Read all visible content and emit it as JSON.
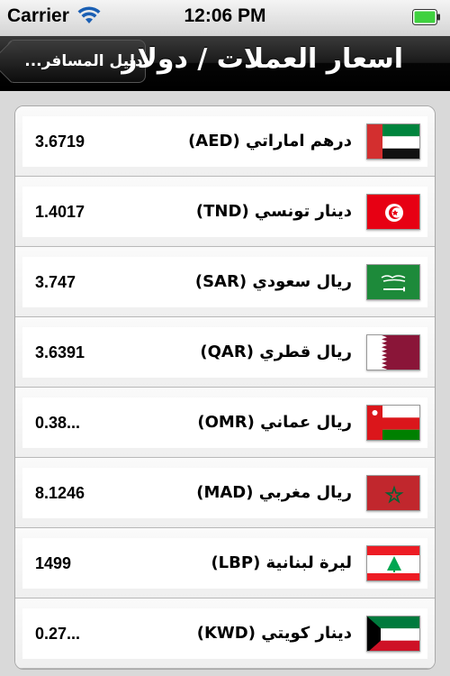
{
  "status_bar": {
    "carrier": "Carrier",
    "time": "12:06 PM"
  },
  "nav": {
    "title": "اسعار العملات / دولار",
    "back_label": "دليل المسافر..."
  },
  "currencies": [
    {
      "name": "درهم اماراتي (AED)",
      "value": "3.6719",
      "flag": "uae-flag-icon"
    },
    {
      "name": "دينار تونسي (TND)",
      "value": "1.4017",
      "flag": "tunisia-flag-icon"
    },
    {
      "name": "ريال سعودي (SAR)",
      "value": "3.747",
      "flag": "saudi-flag-icon"
    },
    {
      "name": "ريال قطري (QAR)",
      "value": "3.6391",
      "flag": "qatar-flag-icon"
    },
    {
      "name": "ريال عماني (OMR)",
      "value": "0.38...",
      "flag": "oman-flag-icon"
    },
    {
      "name": "ريال مغربي (MAD)",
      "value": "8.1246",
      "flag": "morocco-flag-icon"
    },
    {
      "name": "ليرة لبنانية (LBP)",
      "value": "1499",
      "flag": "lebanon-flag-icon"
    },
    {
      "name": "دينار كويتي (KWD)",
      "value": "0.27...",
      "flag": "kuwait-flag-icon"
    }
  ],
  "colors": {
    "nav_bg": "#000000",
    "content_bg": "#d9d9d9",
    "battery_fill": "#3fd13f"
  }
}
